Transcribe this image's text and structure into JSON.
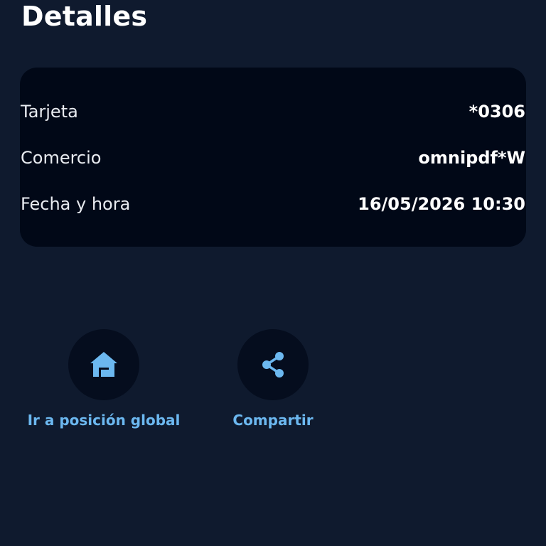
{
  "header": {
    "title": "Detalles"
  },
  "details": {
    "rows": [
      {
        "label": "Tarjeta",
        "value": "*0306"
      },
      {
        "label": "Comercio",
        "value": "omnipdf*W"
      },
      {
        "label": "Fecha y hora",
        "value": "16/05/2026 10:30"
      }
    ]
  },
  "actions": [
    {
      "label": "Ir a posición global",
      "icon": "home-icon"
    },
    {
      "label": "Compartir",
      "icon": "share-icon"
    }
  ],
  "colors": {
    "background": "#0f1a2e",
    "card": "#010817",
    "accent": "#6cb8f0"
  }
}
